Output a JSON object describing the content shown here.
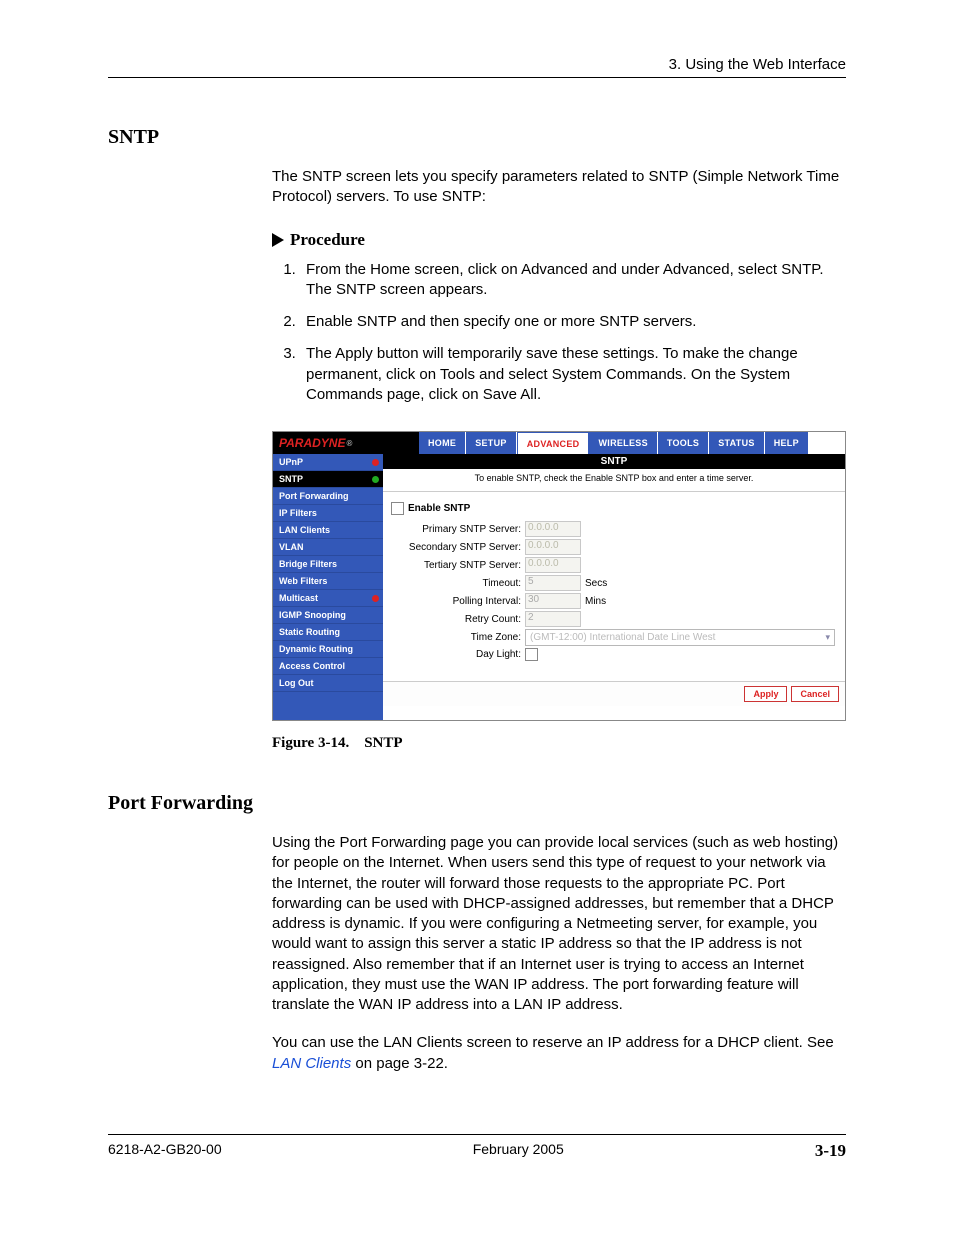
{
  "header": {
    "chapter": "3. Using the Web Interface"
  },
  "section1": {
    "title": "SNTP",
    "intro": "The SNTP screen lets you specify parameters related to SNTP (Simple Network Time Protocol) servers. To use SNTP:",
    "procedure_label": "Procedure",
    "steps": [
      "From the Home screen, click on Advanced and under Advanced, select SNTP. The SNTP screen appears.",
      "Enable SNTP and then specify one or more SNTP servers.",
      "The Apply button will temporarily save these settings. To make the change permanent, click on Tools and select System Commands. On the System Commands page, click on Save All."
    ]
  },
  "screenshot": {
    "brand": "PARADYNE",
    "tabs": [
      "HOME",
      "SETUP",
      "ADVANCED",
      "WIRELESS",
      "TOOLS",
      "STATUS",
      "HELP"
    ],
    "active_tab": "ADVANCED",
    "sidebar": [
      {
        "label": "UPnP",
        "dot": "red"
      },
      {
        "label": "SNTP",
        "dot": "green",
        "current": true
      },
      {
        "label": "Port Forwarding"
      },
      {
        "label": "IP Filters"
      },
      {
        "label": "LAN Clients"
      },
      {
        "label": "VLAN"
      },
      {
        "label": "Bridge Filters"
      },
      {
        "label": "Web Filters"
      },
      {
        "label": "Multicast",
        "dot": "red"
      },
      {
        "label": "IGMP Snooping"
      },
      {
        "label": "Static Routing"
      },
      {
        "label": "Dynamic Routing"
      },
      {
        "label": "Access Control"
      },
      {
        "label": "Log Out"
      }
    ],
    "panel_title": "SNTP",
    "panel_subtitle": "To enable SNTP, check the Enable SNTP box and enter a time server.",
    "enable_label": "Enable SNTP",
    "fields": {
      "primary": {
        "label": "Primary SNTP Server:",
        "value": "0.0.0.0"
      },
      "secondary": {
        "label": "Secondary SNTP Server:",
        "value": "0.0.0.0"
      },
      "tertiary": {
        "label": "Tertiary SNTP Server:",
        "value": "0.0.0.0"
      },
      "timeout": {
        "label": "Timeout:",
        "value": "5",
        "unit": "Secs"
      },
      "poll": {
        "label": "Polling Interval:",
        "value": "30",
        "unit": "Mins"
      },
      "retry": {
        "label": "Retry Count:",
        "value": "2"
      },
      "tz": {
        "label": "Time Zone:",
        "value": "(GMT-12:00) International Date Line West"
      },
      "daylight": {
        "label": "Day Light:"
      }
    },
    "buttons": {
      "apply": "Apply",
      "cancel": "Cancel"
    }
  },
  "figure_caption": "Figure 3-14. SNTP",
  "section2": {
    "title": "Port Forwarding",
    "p1": "Using the Port Forwarding page you can provide local services (such as web hosting) for people on the Internet. When users send this type of request to your network via the Internet, the router will forward those requests to the appropriate PC. Port forwarding can be used with DHCP-assigned addresses, but remember that a DHCP address is dynamic. If you were configuring a Netmeeting server, for example, you would want to assign this server a static IP address so that the IP address is not reassigned. Also remember that if an Internet user is trying to access an Internet application, they must use the WAN IP address. The port forwarding feature will translate the WAN IP address into a LAN IP address.",
    "p2a": "You can use the LAN Clients screen to reserve an IP address for a DHCP client. See ",
    "p2_link": "LAN Clients",
    "p2b": " on page 3-22."
  },
  "footer": {
    "left": "6218-A2-GB20-00",
    "center": "February 2005",
    "right": "3-19"
  }
}
